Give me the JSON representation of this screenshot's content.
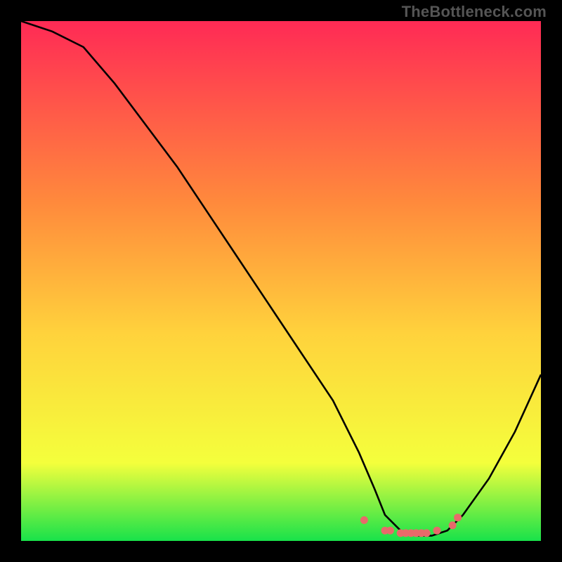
{
  "watermark": "TheBottleneck.com",
  "colors": {
    "page_bg": "#000000",
    "grad_top": "#ff2a55",
    "grad_mid1": "#ff8a3c",
    "grad_mid2": "#ffd23c",
    "grad_mid3": "#f4ff3c",
    "grad_bottom": "#18e24a",
    "curve": "#000000",
    "marker": "#e86a6a"
  },
  "chart_data": {
    "type": "line",
    "title": "",
    "xlabel": "",
    "ylabel": "",
    "xlim": [
      0,
      100
    ],
    "ylim": [
      0,
      100
    ],
    "series": [
      {
        "name": "curve",
        "x": [
          0,
          6,
          12,
          18,
          24,
          30,
          36,
          42,
          48,
          54,
          60,
          65,
          68,
          70,
          73,
          76,
          79,
          82,
          85,
          90,
          95,
          100
        ],
        "values": [
          100,
          98,
          95,
          88,
          80,
          72,
          63,
          54,
          45,
          36,
          27,
          17,
          10,
          5,
          2,
          1,
          1,
          2,
          5,
          12,
          21,
          32
        ]
      }
    ],
    "markers": {
      "name": "valley-dots",
      "x": [
        66,
        70,
        71,
        73,
        74,
        75,
        76,
        77,
        78,
        80,
        83,
        84
      ],
      "values": [
        4,
        2,
        2,
        1.5,
        1.5,
        1.5,
        1.5,
        1.5,
        1.5,
        2,
        3,
        4.5
      ]
    }
  }
}
